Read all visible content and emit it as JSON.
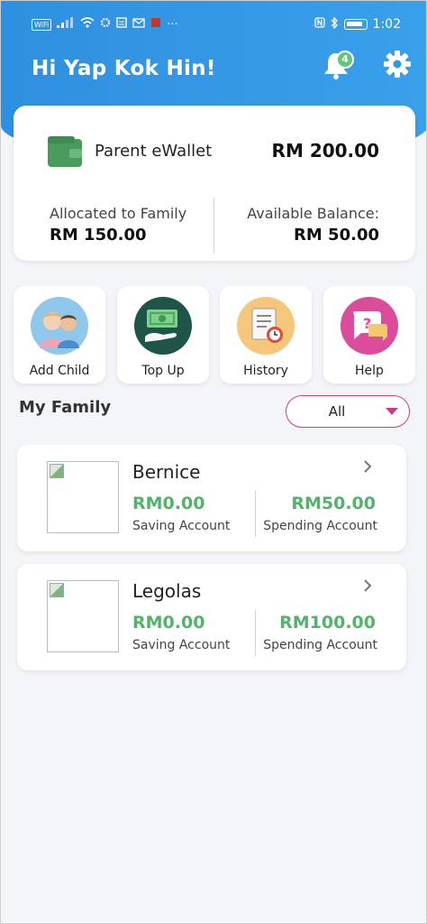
{
  "status_bar": {
    "carrier_chip": "WiFi",
    "time": "1:02"
  },
  "header": {
    "greeting": "Hi Yap Kok Hin!",
    "notification_count": "4"
  },
  "wallet": {
    "label": "Parent eWallet",
    "amount": "RM 200.00",
    "allocated_label": "Allocated to Family",
    "allocated_value": "RM 150.00",
    "available_label": "Available Balance:",
    "available_value": "RM 50.00"
  },
  "actions": [
    {
      "label": "Add Child",
      "icon": "family-icon"
    },
    {
      "label": "Top Up",
      "icon": "cash-hand-icon"
    },
    {
      "label": "History",
      "icon": "receipt-clock-icon"
    },
    {
      "label": "Help",
      "icon": "question-chat-icon"
    }
  ],
  "family": {
    "title": "My Family",
    "filter_value": "All",
    "children": [
      {
        "name": "Bernice",
        "saving_amount": "RM0.00",
        "saving_label": "Saving Account",
        "spending_amount": "RM50.00",
        "spending_label": "Spending Account"
      },
      {
        "name": "Legolas",
        "saving_amount": "RM0.00",
        "saving_label": "Saving Account",
        "spending_amount": "RM100.00",
        "spending_label": "Spending Account"
      }
    ]
  },
  "colors": {
    "header_blue": "#2f8fe0",
    "accent_green": "#53b36a",
    "accent_pink": "#c9417c"
  }
}
